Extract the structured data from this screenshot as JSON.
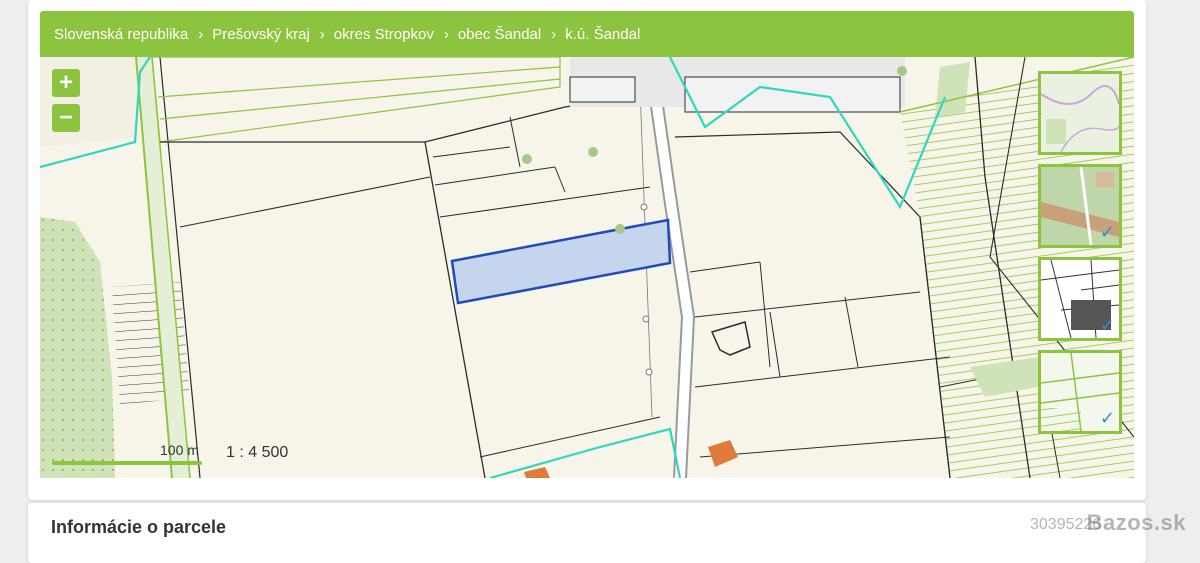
{
  "breadcrumb": {
    "items": [
      "Slovenská republika",
      "Prešovský kraj",
      "okres Stropkov",
      "obec Šandal",
      "k.ú. Šandal"
    ],
    "separator": "›"
  },
  "map": {
    "zoom_in_label": "+",
    "zoom_out_label": "−",
    "scale_label": "100 m",
    "scale_ratio": "1 : 4 500",
    "layers": [
      {
        "name": "topographic-layer",
        "checked": false
      },
      {
        "name": "orthophoto-layer",
        "checked": true
      },
      {
        "name": "cadastral-c-layer",
        "checked": true
      },
      {
        "name": "cadastral-e-layer",
        "checked": true
      }
    ],
    "colors": {
      "accent": "#8cc43f",
      "selected_parcel_fill": "#c5d5ee",
      "selected_parcel_stroke": "#1f4bbf",
      "boundary_cyan": "#2fd6c0",
      "parcel_line": "#2b2b2b",
      "hatch_green": "#8cc43f"
    }
  },
  "info": {
    "title": "Informácie o parcele"
  },
  "watermark": {
    "id_text": "30395226",
    "site": "Bazos.sk"
  }
}
